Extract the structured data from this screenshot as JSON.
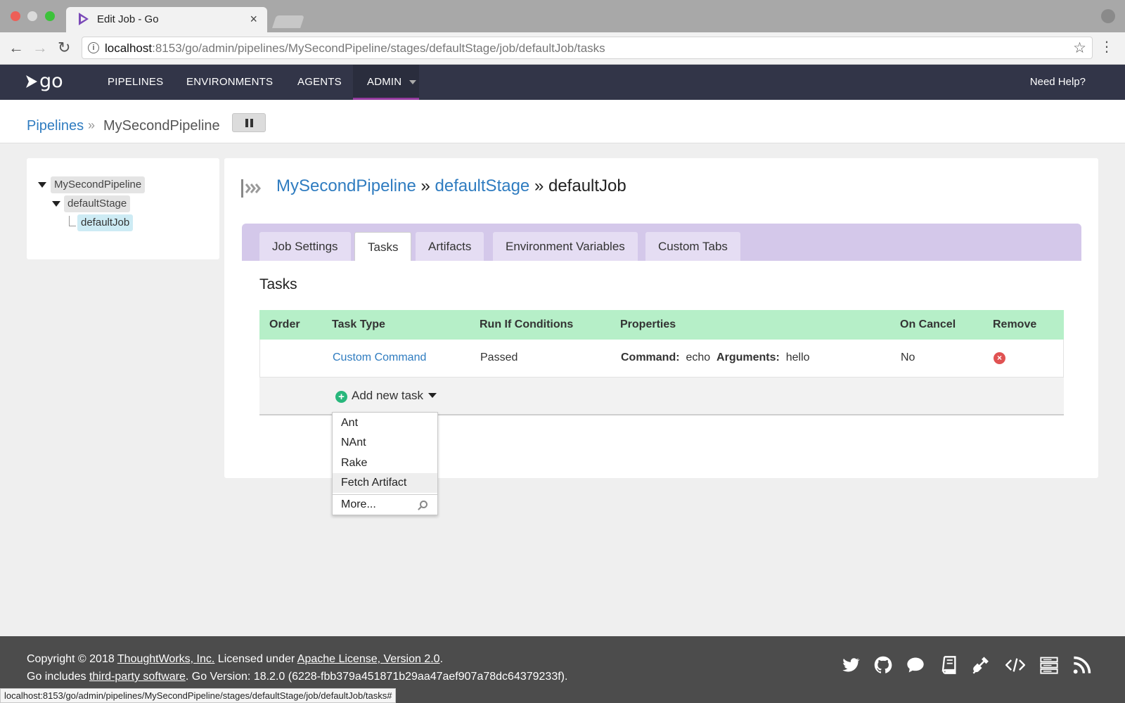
{
  "browser": {
    "tab_title": "Edit Job - Go",
    "tab_close": "×",
    "url_host": "localhost",
    "url_rest": ":8153/go/admin/pipelines/MySecondPipeline/stages/defaultStage/job/defaultJob/tasks",
    "status_url": "localhost:8153/go/admin/pipelines/MySecondPipeline/stages/defaultStage/job/defaultJob/tasks#"
  },
  "header": {
    "logo": "go",
    "nav": [
      "PIPELINES",
      "ENVIRONMENTS",
      "AGENTS",
      "ADMIN"
    ],
    "need_help": "Need Help?"
  },
  "breadcrumb": {
    "root": "Pipelines",
    "separator": "»",
    "current": "MySecondPipeline"
  },
  "tree": {
    "pipeline": "MySecondPipeline",
    "stage": "defaultStage",
    "job": "defaultJob"
  },
  "main": {
    "heading": {
      "pipeline": "MySecondPipeline",
      "sep1": "»",
      "stage": "defaultStage",
      "sep2": "»",
      "job": "defaultJob"
    },
    "tabs": [
      "Job Settings",
      "Tasks",
      "Artifacts",
      "Environment Variables",
      "Custom Tabs"
    ],
    "active_tab": "Tasks",
    "section_title": "Tasks",
    "table": {
      "columns": [
        "Order",
        "Task Type",
        "Run If Conditions",
        "Properties",
        "On Cancel",
        "Remove"
      ],
      "rows": [
        {
          "task_type": "Custom Command",
          "run_if": "Passed",
          "command_label": "Command:",
          "command_value": "echo",
          "arguments_label": "Arguments:",
          "arguments_value": "hello",
          "on_cancel": "No"
        }
      ]
    },
    "add_task_label": "Add new task",
    "dropdown": [
      "Ant",
      "NAnt",
      "Rake",
      "Fetch Artifact"
    ],
    "dropdown_more": "More..."
  },
  "footer": {
    "copyright_pre": "Copyright © 2018 ",
    "thoughtworks": "ThoughtWorks, Inc.",
    "licensed": " Licensed under ",
    "license": "Apache License, Version 2.0",
    "period": ".",
    "includes_pre": "Go includes ",
    "third_party": "third-party software",
    "version": ". Go Version: 18.2.0 (6228-fbb379a451871b29aa47aef907a78dc64379233f)."
  },
  "colors": {
    "header_bg": "#323548",
    "admin_underline": "#943a9e",
    "link": "#2f7cc0",
    "tabbar_bg": "#d4c8ea",
    "table_header_bg": "#b6efc8",
    "add_icon": "#28b77c",
    "remove_icon": "#e05252",
    "footer_bg": "#4c4c4c"
  },
  "icons": [
    "twitter-icon",
    "github-icon",
    "chat-icon",
    "docs-icon",
    "plugin-icon",
    "api-icon",
    "server-icon",
    "rss-icon"
  ]
}
